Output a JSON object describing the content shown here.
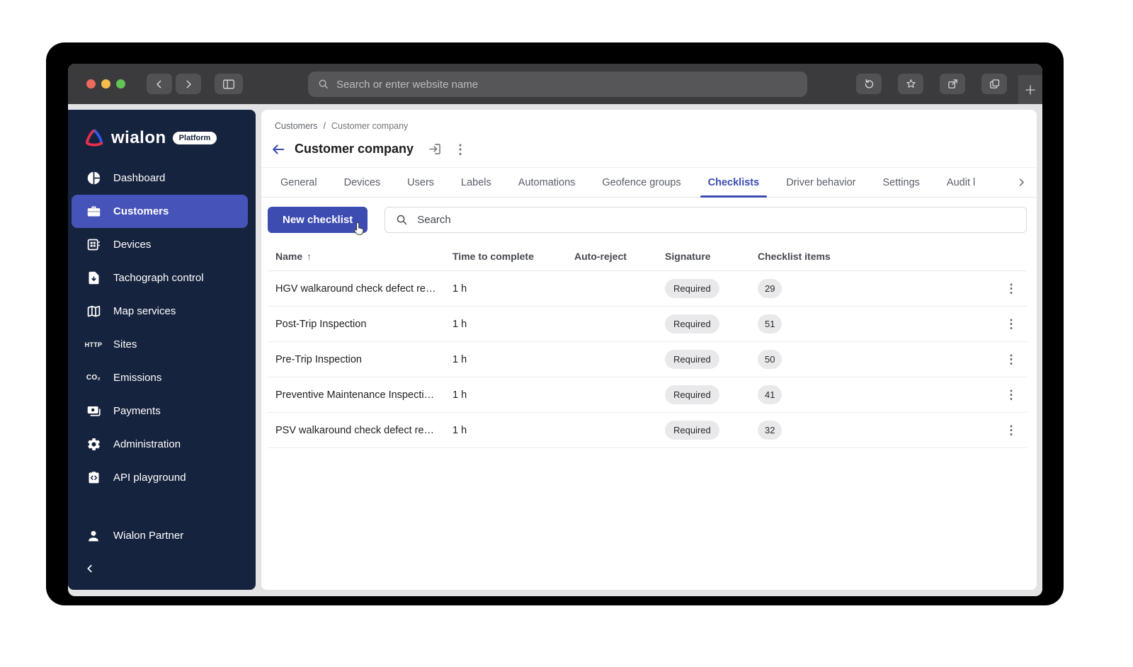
{
  "browser": {
    "address_placeholder": "Search or enter website name"
  },
  "sidebar": {
    "logo_text": "wialon",
    "logo_badge": "Platform",
    "items": [
      {
        "label": "Dashboard",
        "icon": "dashboard-icon",
        "active": false
      },
      {
        "label": "Customers",
        "icon": "briefcase-icon",
        "active": true
      },
      {
        "label": "Devices",
        "icon": "devices-icon",
        "active": false
      },
      {
        "label": "Tachograph control",
        "icon": "tachograph-icon",
        "active": false
      },
      {
        "label": "Map services",
        "icon": "map-icon",
        "active": false
      },
      {
        "label": "Sites",
        "icon": "http-icon",
        "active": false
      },
      {
        "label": "Emissions",
        "icon": "co2-icon",
        "active": false
      },
      {
        "label": "Payments",
        "icon": "payments-icon",
        "active": false
      },
      {
        "label": "Administration",
        "icon": "gear-icon",
        "active": false
      },
      {
        "label": "API playground",
        "icon": "api-icon",
        "active": false
      }
    ],
    "footer_item": "Wialon Partner"
  },
  "header": {
    "breadcrumb_parent": "Customers",
    "breadcrumb_separator": "/",
    "breadcrumb_current": "Customer company",
    "title": "Customer company"
  },
  "tabs": {
    "items": [
      "General",
      "Devices",
      "Users",
      "Labels",
      "Automations",
      "Geofence groups",
      "Checklists",
      "Driver behavior",
      "Settings",
      "Audit l"
    ],
    "active": "Checklists"
  },
  "toolbar": {
    "new_checklist_label": "New checklist",
    "search_placeholder": "Search"
  },
  "table": {
    "columns": [
      "Name",
      "Time to complete",
      "Auto-reject",
      "Signature",
      "Checklist items"
    ],
    "sort_column": "Name",
    "sort_direction": "asc",
    "rows": [
      {
        "name": "HGV walkaround check defect re…",
        "time_to_complete": "1 h",
        "auto_reject": "",
        "signature": "Required",
        "checklist_items": "29"
      },
      {
        "name": "Post-Trip Inspection",
        "time_to_complete": "1 h",
        "auto_reject": "",
        "signature": "Required",
        "checklist_items": "51"
      },
      {
        "name": "Pre-Trip Inspection",
        "time_to_complete": "1 h",
        "auto_reject": "",
        "signature": "Required",
        "checklist_items": "50"
      },
      {
        "name": "Preventive Maintenance Inspecti…",
        "time_to_complete": "1 h",
        "auto_reject": "",
        "signature": "Required",
        "checklist_items": "41"
      },
      {
        "name": "PSV walkaround check defect re…",
        "time_to_complete": "1 h",
        "auto_reject": "",
        "signature": "Required",
        "checklist_items": "32"
      }
    ]
  },
  "colors": {
    "accent": "#3c4cb1",
    "sidebar_bg": "#16233e",
    "sidebar_active": "#4653b8",
    "logo_red": "#e8304a",
    "logo_blue": "#2f5af0",
    "pill_bg": "#e9e9eb"
  }
}
